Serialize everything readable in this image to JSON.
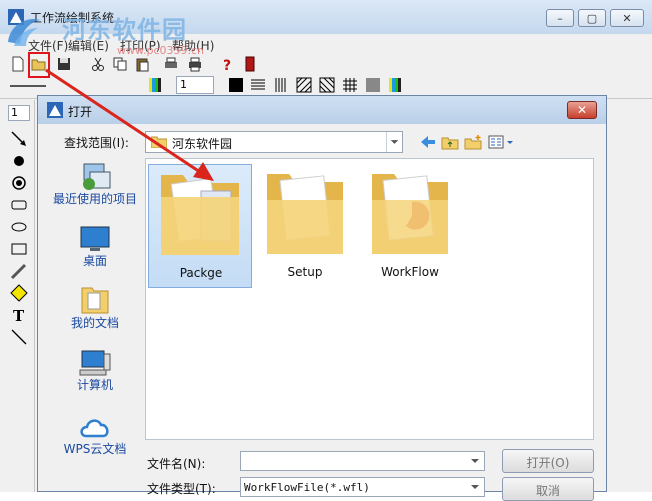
{
  "app": {
    "title": "工作流绘制系统",
    "watermark_text": "河东软件园",
    "watermark_url": "www.pc0359.cn"
  },
  "menu": {
    "items": [
      {
        "label": "文件(F)"
      },
      {
        "label": "编辑(E)"
      },
      {
        "label": "打印(P)"
      },
      {
        "label": "帮助(H)"
      }
    ]
  },
  "toolbar2": {
    "line_width": "1"
  },
  "left_toolbar": {
    "size_value": "1"
  },
  "dialog": {
    "title": "打开",
    "lookin_label": "查找范围(I):",
    "lookin_value": "河东软件园",
    "places": [
      {
        "label": "最近使用的项目",
        "icon": "recent-items-icon"
      },
      {
        "label": "桌面",
        "icon": "desktop-icon"
      },
      {
        "label": "我的文档",
        "icon": "documents-icon"
      },
      {
        "label": "计算机",
        "icon": "computer-icon"
      },
      {
        "label": "WPS云文档",
        "icon": "cloud-icon"
      }
    ],
    "files": [
      {
        "name": "Packge",
        "selected": true
      },
      {
        "name": "Setup",
        "selected": false
      },
      {
        "name": "WorkFlow",
        "selected": false
      }
    ],
    "filename_label": "文件名(N):",
    "filename_value": "",
    "filetype_label": "文件类型(T):",
    "filetype_value": "WorkFlowFile(*.wfl)",
    "open_label": "打开(O)",
    "cancel_label": "取消"
  },
  "colors": {
    "accent": "#3a78c9",
    "highlight_box": "#e0141e",
    "arrow": "#d9251c",
    "folder": "#f2cf6a"
  }
}
